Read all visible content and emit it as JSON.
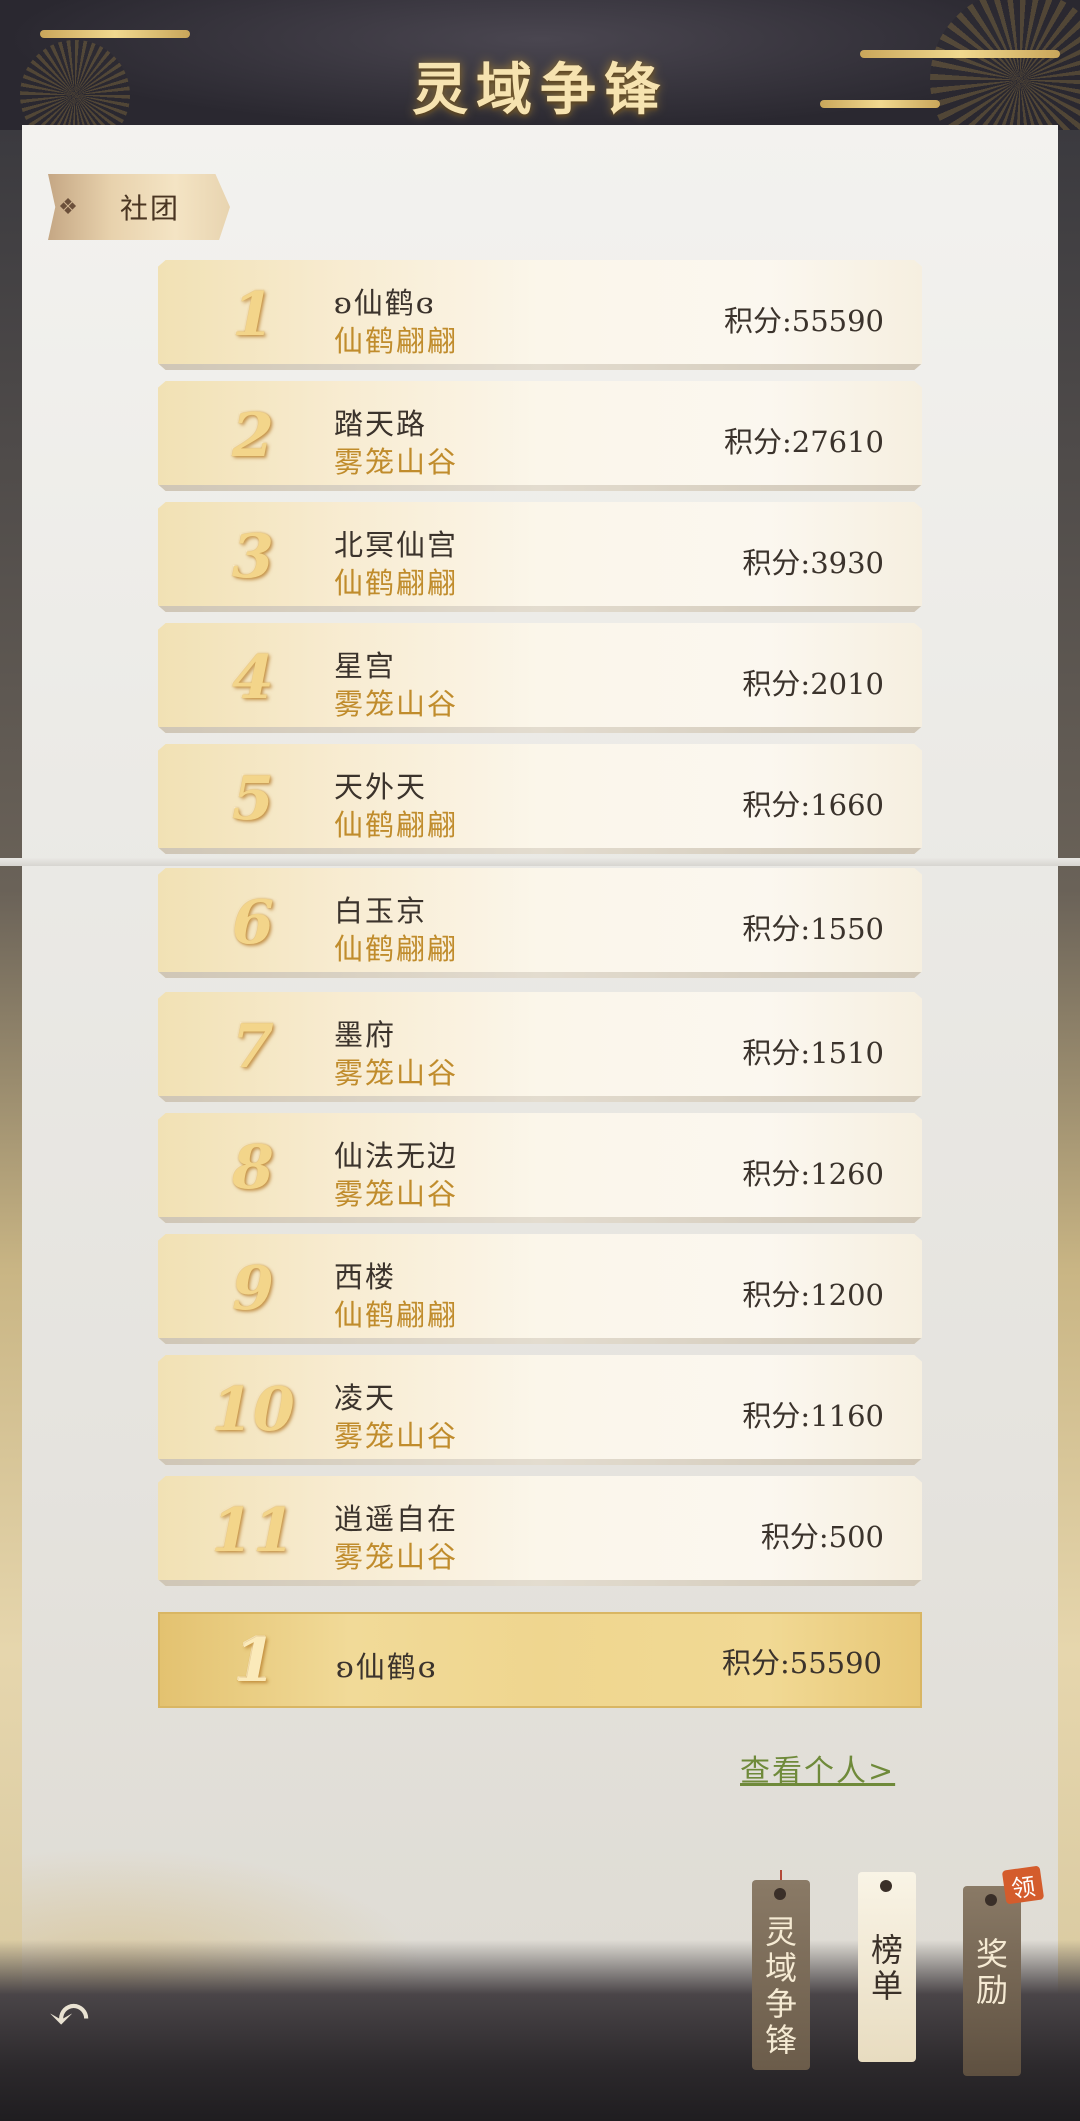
{
  "title": "灵域争锋",
  "tab_label": "社团",
  "rows": [
    {
      "rank": "1",
      "name": "ʚ仙鹤ɞ",
      "server": "仙鹤翩翩",
      "score": "积分:55590"
    },
    {
      "rank": "2",
      "name": "踏天路",
      "server": "雾笼山谷",
      "score": "积分:27610"
    },
    {
      "rank": "3",
      "name": "北冥仙宫",
      "server": "仙鹤翩翩",
      "score": "积分:3930"
    },
    {
      "rank": "4",
      "name": "星宫",
      "server": "雾笼山谷",
      "score": "积分:2010"
    },
    {
      "rank": "5",
      "name": "天外天",
      "server": "仙鹤翩翩",
      "score": "积分:1660"
    },
    {
      "rank": "6",
      "name": "白玉京",
      "server": "仙鹤翩翩",
      "score": "积分:1550"
    },
    {
      "rank": "7",
      "name": "墨府",
      "server": "雾笼山谷",
      "score": "积分:1510"
    },
    {
      "rank": "8",
      "name": "仙法无边",
      "server": "雾笼山谷",
      "score": "积分:1260"
    },
    {
      "rank": "9",
      "name": "西楼",
      "server": "仙鹤翩翩",
      "score": "积分:1200"
    },
    {
      "rank": "10",
      "name": "凌天",
      "server": "雾笼山谷",
      "score": "积分:1160"
    },
    {
      "rank": "11",
      "name": "逍遥自在",
      "server": "雾笼山谷",
      "score": "积分:500"
    }
  ],
  "mine": {
    "rank": "1",
    "name": "ʚ仙鹤ɞ",
    "score": "积分:55590"
  },
  "view_personal": "查看个人>",
  "tabs": [
    {
      "label": "灵域争锋",
      "chars": [
        "灵",
        "域",
        "争",
        "锋"
      ]
    },
    {
      "label": "榜单",
      "chars": [
        "榜",
        "单"
      ]
    },
    {
      "label": "奖励",
      "chars": [
        "奖",
        "励"
      ]
    }
  ],
  "reward_badge": "领",
  "icons": {
    "tab_marker": "diamond-icon",
    "back": "back-arrow-icon"
  }
}
